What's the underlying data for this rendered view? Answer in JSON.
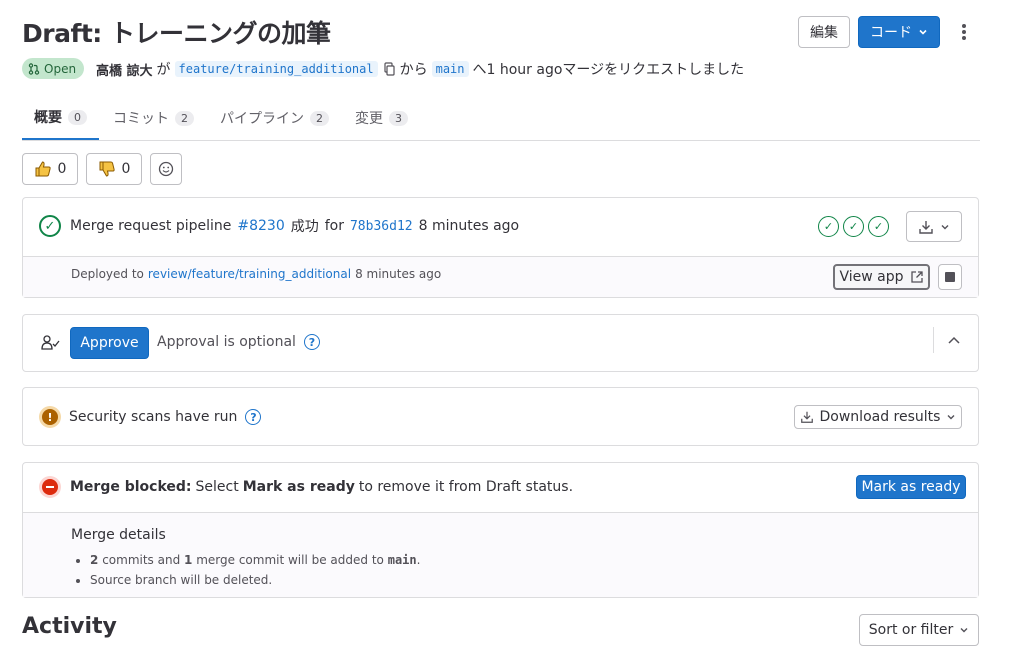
{
  "title": "Draft: トレーニングの加筆",
  "header": {
    "edit_label": "編集",
    "code_label": "コード",
    "more_icon": "kebab-icon"
  },
  "status": {
    "badge": "Open",
    "author": "高橋 諒大",
    "ga": "が",
    "source_branch": "feature/training_additional",
    "kara": "から",
    "target_branch": "main",
    "tail": "へ1 hour agoマージをリクエストしました"
  },
  "tabs": [
    {
      "label": "概要",
      "count": "0"
    },
    {
      "label": "コミット",
      "count": "2"
    },
    {
      "label": "パイプライン",
      "count": "2"
    },
    {
      "label": "変更",
      "count": "3"
    }
  ],
  "reactions": {
    "thumbs_up": "0",
    "thumbs_down": "0"
  },
  "pipeline": {
    "prefix": "Merge request pipeline",
    "id": "#8230",
    "status": "成功",
    "for": "for",
    "sha": "78b36d12",
    "time": "8 minutes ago",
    "deploy_prefix": "Deployed to",
    "deploy_env": "review/feature/training_additional",
    "deploy_time": "8 minutes ago",
    "view_app": "View app"
  },
  "approval": {
    "approve_label": "Approve",
    "text": "Approval is optional"
  },
  "security": {
    "text": "Security scans have run",
    "download_label": "Download results"
  },
  "merge": {
    "blocked_label": "Merge blocked:",
    "select": "Select",
    "mark_ready_strong": "Mark as ready",
    "rest": "to remove it from Draft status.",
    "mark_ready_button": "Mark as ready",
    "details_title": "Merge details",
    "d1_count": "2",
    "d1_a": "commits and",
    "d1_count2": "1",
    "d1_b": "merge commit will be added to",
    "d1_branch": "main",
    "d1_end": ".",
    "d2": "Source branch will be deleted."
  },
  "activity": {
    "title": "Activity",
    "sort_label": "Sort or filter"
  },
  "colors": {
    "primary": "#1f75cb",
    "success": "#108548",
    "danger": "#dd2b0e",
    "warning": "#ab6100"
  }
}
